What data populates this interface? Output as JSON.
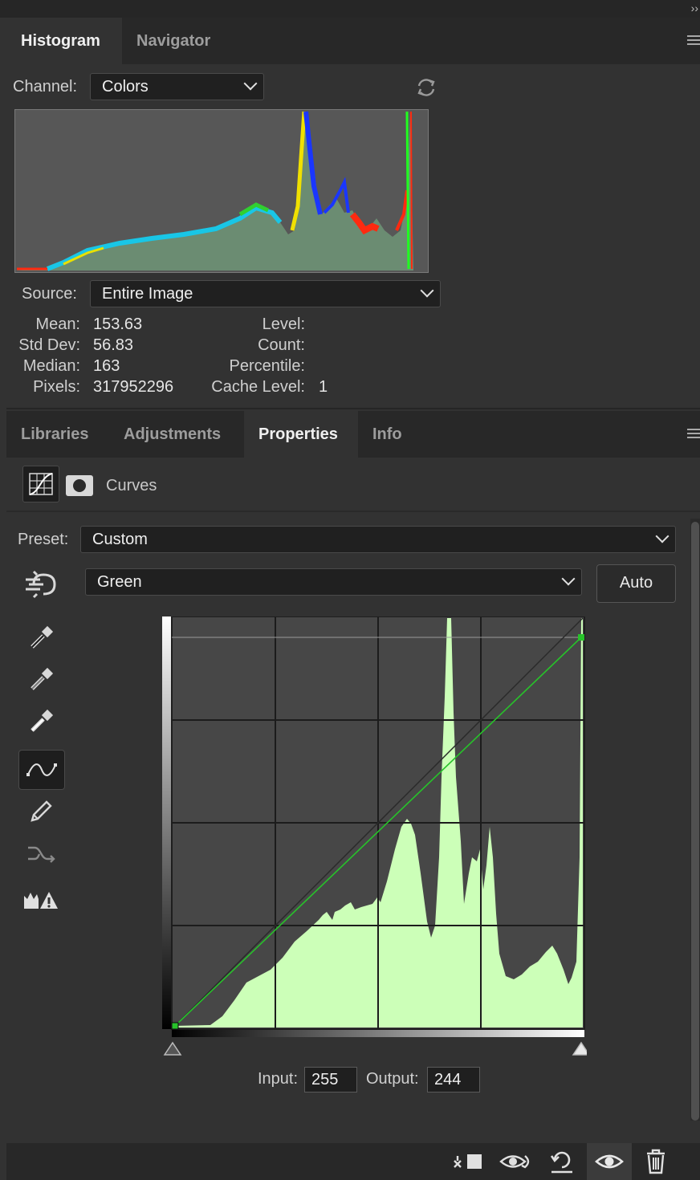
{
  "histogram_panel": {
    "tabs": [
      {
        "label": "Histogram"
      },
      {
        "label": "Navigator"
      }
    ],
    "channel_label": "Channel:",
    "channel_value": "Colors",
    "source_label": "Source:",
    "source_value": "Entire Image",
    "stats": {
      "mean_label": "Mean:",
      "mean": "153.63",
      "stddev_label": "Std Dev:",
      "stddev": "56.83",
      "median_label": "Median:",
      "median": "163",
      "pixels_label": "Pixels:",
      "pixels": "317952296",
      "level_label": "Level:",
      "level": "",
      "count_label": "Count:",
      "count": "",
      "percentile_label": "Percentile:",
      "percentile": "",
      "cache_label": "Cache Level:",
      "cache": "1"
    }
  },
  "properties_panel": {
    "tabs": [
      {
        "label": "Libraries"
      },
      {
        "label": "Adjustments"
      },
      {
        "label": "Properties"
      },
      {
        "label": "Info"
      }
    ],
    "active_tab": "Properties",
    "adjustment_name": "Curves",
    "preset_label": "Preset:",
    "preset_value": "Custom",
    "curve_channel": "Green",
    "auto_label": "Auto",
    "input_label": "Input:",
    "input_value": "255",
    "output_label": "Output:",
    "output_value": "244",
    "tools": [
      "sample-shadow-eyedropper-icon",
      "sample-midtone-eyedropper-icon",
      "sample-highlight-eyedropper-icon",
      "curve-points-icon",
      "pencil-icon",
      "smooth-icon",
      "clipping-warning-icon"
    ],
    "curve_points": [
      {
        "input": 0,
        "output": 0
      },
      {
        "input": 255,
        "output": 244
      }
    ]
  },
  "bottom_icons": [
    "clip-to-layer-icon",
    "view-previous-icon",
    "reset-icon",
    "visibility-icon",
    "delete-icon"
  ],
  "colors": {
    "accent_green": "#27c22a",
    "histogram_fill": "#ccffb8"
  }
}
